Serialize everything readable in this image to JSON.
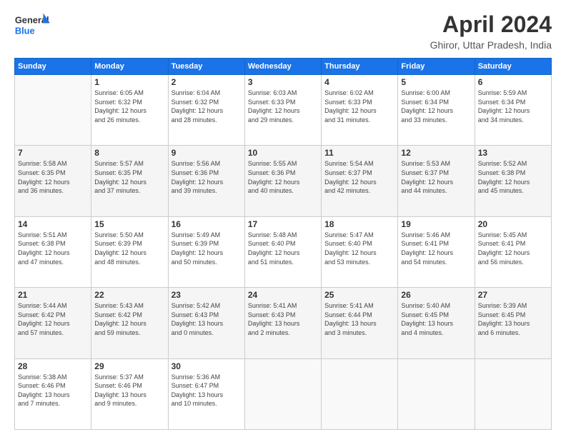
{
  "header": {
    "logo_line1": "General",
    "logo_line2": "Blue",
    "title": "April 2024",
    "subtitle": "Ghiror, Uttar Pradesh, India"
  },
  "calendar": {
    "headers": [
      "Sunday",
      "Monday",
      "Tuesday",
      "Wednesday",
      "Thursday",
      "Friday",
      "Saturday"
    ],
    "rows": [
      [
        {
          "day": "",
          "empty": true
        },
        {
          "day": "1",
          "sunrise": "6:05 AM",
          "sunset": "6:32 PM",
          "daylight": "12 hours and 26 minutes."
        },
        {
          "day": "2",
          "sunrise": "6:04 AM",
          "sunset": "6:32 PM",
          "daylight": "12 hours and 28 minutes."
        },
        {
          "day": "3",
          "sunrise": "6:03 AM",
          "sunset": "6:33 PM",
          "daylight": "12 hours and 29 minutes."
        },
        {
          "day": "4",
          "sunrise": "6:02 AM",
          "sunset": "6:33 PM",
          "daylight": "12 hours and 31 minutes."
        },
        {
          "day": "5",
          "sunrise": "6:00 AM",
          "sunset": "6:34 PM",
          "daylight": "12 hours and 33 minutes."
        },
        {
          "day": "6",
          "sunrise": "5:59 AM",
          "sunset": "6:34 PM",
          "daylight": "12 hours and 34 minutes."
        }
      ],
      [
        {
          "day": "7",
          "sunrise": "5:58 AM",
          "sunset": "6:35 PM",
          "daylight": "12 hours and 36 minutes."
        },
        {
          "day": "8",
          "sunrise": "5:57 AM",
          "sunset": "6:35 PM",
          "daylight": "12 hours and 37 minutes."
        },
        {
          "day": "9",
          "sunrise": "5:56 AM",
          "sunset": "6:36 PM",
          "daylight": "12 hours and 39 minutes."
        },
        {
          "day": "10",
          "sunrise": "5:55 AM",
          "sunset": "6:36 PM",
          "daylight": "12 hours and 40 minutes."
        },
        {
          "day": "11",
          "sunrise": "5:54 AM",
          "sunset": "6:37 PM",
          "daylight": "12 hours and 42 minutes."
        },
        {
          "day": "12",
          "sunrise": "5:53 AM",
          "sunset": "6:37 PM",
          "daylight": "12 hours and 44 minutes."
        },
        {
          "day": "13",
          "sunrise": "5:52 AM",
          "sunset": "6:38 PM",
          "daylight": "12 hours and 45 minutes."
        }
      ],
      [
        {
          "day": "14",
          "sunrise": "5:51 AM",
          "sunset": "6:38 PM",
          "daylight": "12 hours and 47 minutes."
        },
        {
          "day": "15",
          "sunrise": "5:50 AM",
          "sunset": "6:39 PM",
          "daylight": "12 hours and 48 minutes."
        },
        {
          "day": "16",
          "sunrise": "5:49 AM",
          "sunset": "6:39 PM",
          "daylight": "12 hours and 50 minutes."
        },
        {
          "day": "17",
          "sunrise": "5:48 AM",
          "sunset": "6:40 PM",
          "daylight": "12 hours and 51 minutes."
        },
        {
          "day": "18",
          "sunrise": "5:47 AM",
          "sunset": "6:40 PM",
          "daylight": "12 hours and 53 minutes."
        },
        {
          "day": "19",
          "sunrise": "5:46 AM",
          "sunset": "6:41 PM",
          "daylight": "12 hours and 54 minutes."
        },
        {
          "day": "20",
          "sunrise": "5:45 AM",
          "sunset": "6:41 PM",
          "daylight": "12 hours and 56 minutes."
        }
      ],
      [
        {
          "day": "21",
          "sunrise": "5:44 AM",
          "sunset": "6:42 PM",
          "daylight": "12 hours and 57 minutes."
        },
        {
          "day": "22",
          "sunrise": "5:43 AM",
          "sunset": "6:42 PM",
          "daylight": "12 hours and 59 minutes."
        },
        {
          "day": "23",
          "sunrise": "5:42 AM",
          "sunset": "6:43 PM",
          "daylight": "13 hours and 0 minutes."
        },
        {
          "day": "24",
          "sunrise": "5:41 AM",
          "sunset": "6:43 PM",
          "daylight": "13 hours and 2 minutes."
        },
        {
          "day": "25",
          "sunrise": "5:41 AM",
          "sunset": "6:44 PM",
          "daylight": "13 hours and 3 minutes."
        },
        {
          "day": "26",
          "sunrise": "5:40 AM",
          "sunset": "6:45 PM",
          "daylight": "13 hours and 4 minutes."
        },
        {
          "day": "27",
          "sunrise": "5:39 AM",
          "sunset": "6:45 PM",
          "daylight": "13 hours and 6 minutes."
        }
      ],
      [
        {
          "day": "28",
          "sunrise": "5:38 AM",
          "sunset": "6:46 PM",
          "daylight": "13 hours and 7 minutes."
        },
        {
          "day": "29",
          "sunrise": "5:37 AM",
          "sunset": "6:46 PM",
          "daylight": "13 hours and 9 minutes."
        },
        {
          "day": "30",
          "sunrise": "5:36 AM",
          "sunset": "6:47 PM",
          "daylight": "13 hours and 10 minutes."
        },
        {
          "day": "",
          "empty": true
        },
        {
          "day": "",
          "empty": true
        },
        {
          "day": "",
          "empty": true
        },
        {
          "day": "",
          "empty": true
        }
      ]
    ]
  }
}
